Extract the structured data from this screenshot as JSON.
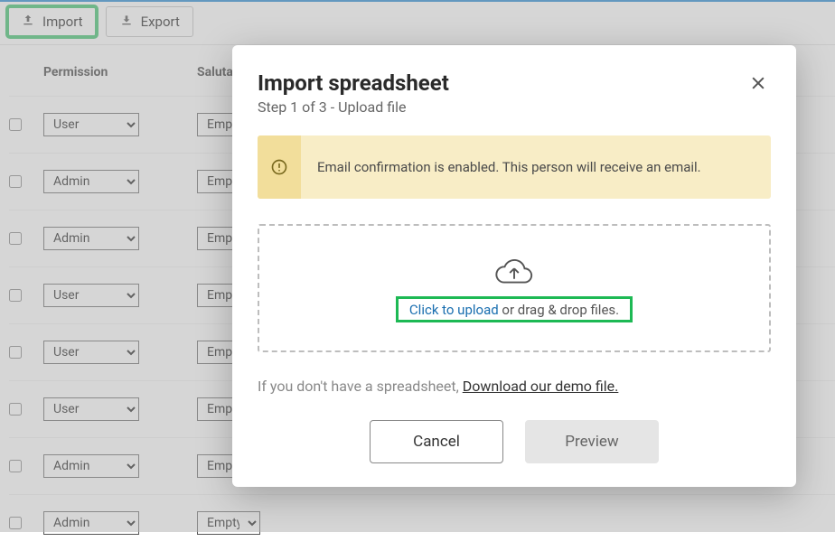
{
  "toolbar": {
    "import_label": "Import",
    "export_label": "Export"
  },
  "table": {
    "headers": {
      "permission": "Permission",
      "salutation": "Salutation"
    },
    "salutation_placeholder": "Empty",
    "rows": [
      {
        "permission": "User"
      },
      {
        "permission": "Admin"
      },
      {
        "permission": "Admin"
      },
      {
        "permission": "User"
      },
      {
        "permission": "User"
      },
      {
        "permission": "User"
      },
      {
        "permission": "Admin"
      },
      {
        "permission": "Admin"
      }
    ]
  },
  "modal": {
    "title": "Import spreadsheet",
    "subtitle": "Step 1 of 3 - Upload file",
    "alert": "Email confirmation is enabled. This person will receive an email.",
    "upload_link": "Click to upload",
    "upload_rest": " or drag & drop files.",
    "hint_prefix": "If you don't have a spreadsheet, ",
    "hint_link": "Download our demo file.",
    "cancel": "Cancel",
    "preview": "Preview"
  }
}
